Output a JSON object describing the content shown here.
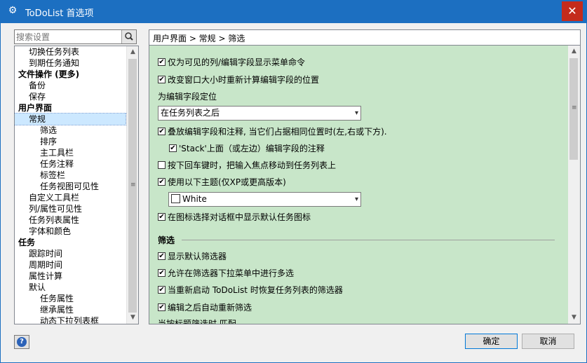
{
  "window": {
    "title": "ToDoList 首选项"
  },
  "search": {
    "placeholder": "搜索设置"
  },
  "tree": [
    {
      "label": "切换任务列表",
      "level": 1
    },
    {
      "label": "到期任务通知",
      "level": 1
    },
    {
      "label": "文件操作 (更多)",
      "level": 0
    },
    {
      "label": "备份",
      "level": 1
    },
    {
      "label": "保存",
      "level": 1
    },
    {
      "label": "用户界面",
      "level": 0
    },
    {
      "label": "常规",
      "level": 1,
      "selected": true
    },
    {
      "label": "筛选",
      "level": 2
    },
    {
      "label": "排序",
      "level": 2
    },
    {
      "label": "主工具栏",
      "level": 2
    },
    {
      "label": "任务注释",
      "level": 2
    },
    {
      "label": "标签栏",
      "level": 2
    },
    {
      "label": "任务视图可见性",
      "level": 2
    },
    {
      "label": "自定义工具栏",
      "level": 1
    },
    {
      "label": "列/属性可见性",
      "level": 1
    },
    {
      "label": "任务列表属性",
      "level": 1
    },
    {
      "label": "字体和颜色",
      "level": 1
    },
    {
      "label": "任务",
      "level": 0
    },
    {
      "label": "跟踪时间",
      "level": 1
    },
    {
      "label": "周期时间",
      "level": 1
    },
    {
      "label": "属性计算",
      "level": 1
    },
    {
      "label": "默认",
      "level": 1
    },
    {
      "label": "任务属性",
      "level": 2
    },
    {
      "label": "继承属性",
      "level": 2
    },
    {
      "label": "动态下拉列表框",
      "level": 2
    }
  ],
  "breadcrumb": "用户界面 > 常规 > 筛选",
  "options": {
    "o1": "仅为可见的列/编辑字段显示菜单命令",
    "o2": "改变窗口大小时重新计算编辑字段的位置",
    "edit_pos_label": "为编辑字段定位",
    "edit_pos_value": "在任务列表之后",
    "o3": "叠放编辑字段和注释, 当它们占据相同位置时(左,右或下方).",
    "o3a": "'Stack'上面（或左边）编辑字段的注释",
    "o4": "按下回车键时，把输入焦点移动到任务列表上",
    "o5": "使用以下主题(仅XP或更高版本)",
    "theme_value": "White",
    "o6": "在图标选择对话框中显示默认任务图标",
    "section_filter": "筛选",
    "f1": "显示默认筛选器",
    "f2": "允许在筛选器下拉菜单中进行多选",
    "f3": "当重新启动 ToDoList 时恢复任务列表的筛选器",
    "f4": "编辑之后自动重新筛选",
    "f5": "当按标题筛选时,匹配"
  },
  "buttons": {
    "ok": "确定",
    "cancel": "取消"
  },
  "colors": {
    "titlebar": "#1c6fc1",
    "panel_bg": "#c8e6c9",
    "selection": "#cce8ff"
  }
}
